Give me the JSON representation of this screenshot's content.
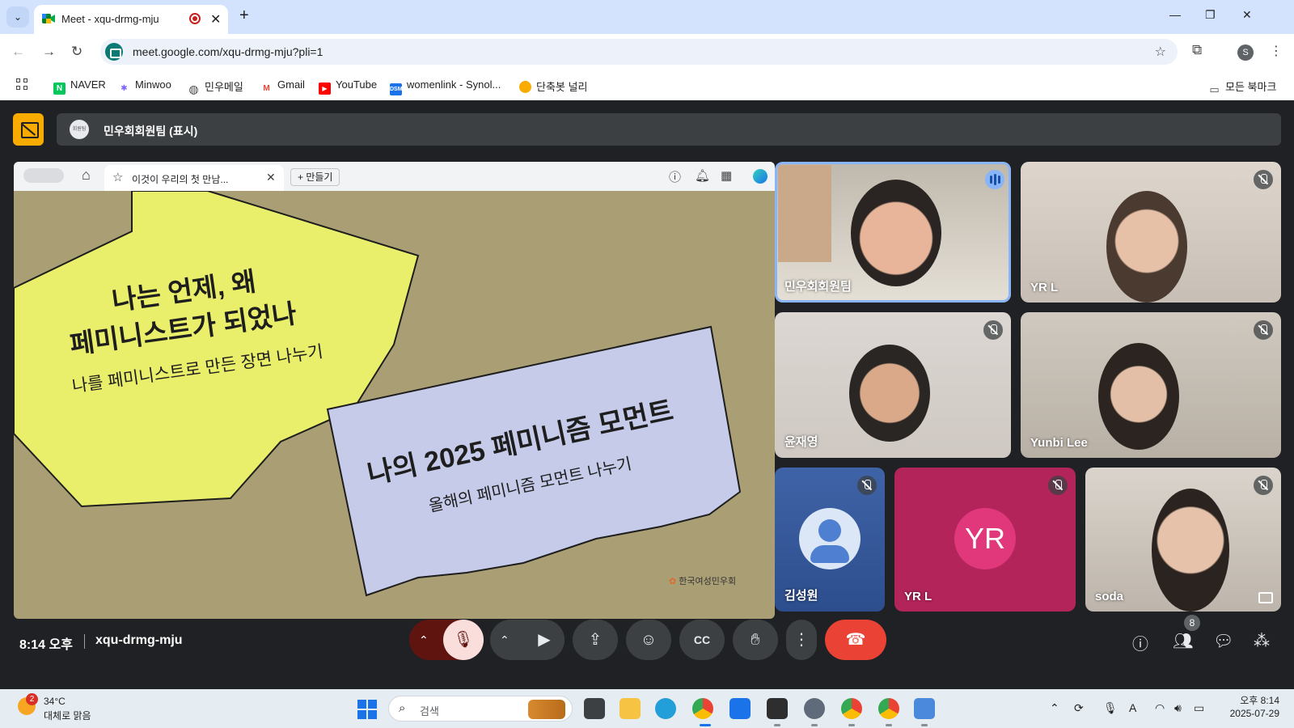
{
  "browser": {
    "tab_title": "Meet - xqu-drmg-mju",
    "url": "meet.google.com/xqu-drmg-mju?pli=1",
    "profile_initial": "S",
    "bookmarks": [
      {
        "label": "NAVER",
        "icon": "naver-icon",
        "color": "#03c75a",
        "glyph": "N"
      },
      {
        "label": "Minwoo",
        "icon": "minwoo-icon",
        "color": "#7b61ff",
        "glyph": "✱"
      },
      {
        "label": "민우메일",
        "icon": "globe-icon",
        "color": "#474747",
        "glyph": "◍"
      },
      {
        "label": "Gmail",
        "icon": "gmail-icon",
        "color": "#ea4335",
        "glyph": "M"
      },
      {
        "label": "YouTube",
        "icon": "youtube-icon",
        "color": "#ff0000",
        "glyph": "▶"
      },
      {
        "label": "womenlink - Synol...",
        "icon": "dsm-icon",
        "color": "#1a73e8",
        "glyph": "D"
      },
      {
        "label": "단축봇 널리",
        "icon": "circle-icon",
        "color": "#f9ab00",
        "glyph": ""
      }
    ],
    "all_bookmarks": "모든 북마크"
  },
  "meet": {
    "banner_text": "민우회회원팀 (표시)",
    "banner_avatar": "회원팀",
    "presentation": {
      "tab_title": "이것이 우리의 첫 만남...",
      "new_button": "+ 만들기",
      "slide_block1_line1": "나는 언제, 왜",
      "slide_block1_line2": "페미니스트가 되었나",
      "slide_block1_sub": "나를 페미니스트로 만든 장면 나누기",
      "slide_block2_title": "나의 2025 페미니즘 모먼트",
      "slide_block2_sub": "올해의 페미니즘 모먼트 나누기",
      "logo_text": "한국여성민우회",
      "colors": {
        "bg": "#aa9e74",
        "yellow": "#e9ef6a",
        "blue": "#c5cbe8"
      }
    },
    "participants": [
      {
        "name": "민우회회원팀",
        "speaking": true
      },
      {
        "name": "YR L",
        "muted": true
      },
      {
        "name": "윤재영",
        "muted": true
      },
      {
        "name": "Yunbi Lee",
        "muted": true
      },
      {
        "name": "김성원",
        "muted": true
      },
      {
        "name": "YR L",
        "muted": true,
        "initials": "YR"
      },
      {
        "name": "soda",
        "muted": true
      }
    ],
    "time": "8:14 오후",
    "meeting_code": "xqu-drmg-mju",
    "people_count": "8"
  },
  "taskbar": {
    "weather_temp": "34°C",
    "weather_desc": "대체로 맑음",
    "weather_badge": "2",
    "search_placeholder": "검색",
    "clock_time": "오후 8:14",
    "clock_date": "2025-07-29"
  }
}
